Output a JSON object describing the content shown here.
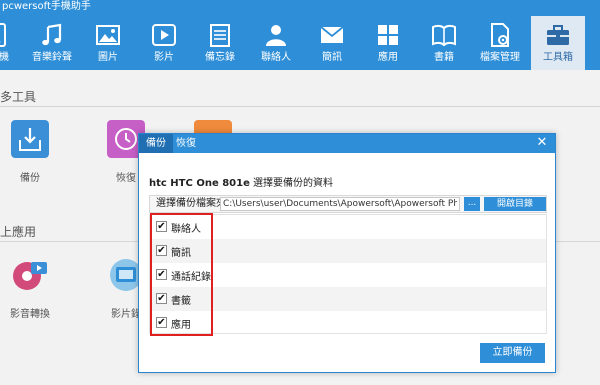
{
  "app": {
    "title": "pcwersoft手機助手"
  },
  "toolbar": {
    "items": [
      {
        "label": "手機",
        "icon": "phone-icon"
      },
      {
        "label": "音樂鈴聲",
        "icon": "music-note-icon"
      },
      {
        "label": "圖片",
        "icon": "picture-icon"
      },
      {
        "label": "影片",
        "icon": "video-play-icon"
      },
      {
        "label": "備忘錄",
        "icon": "notes-icon"
      },
      {
        "label": "聯絡人",
        "icon": "contact-icon"
      },
      {
        "label": "簡訊",
        "icon": "envelope-icon"
      },
      {
        "label": "應用",
        "icon": "apps-grid-icon"
      },
      {
        "label": "書籍",
        "icon": "book-icon"
      },
      {
        "label": "檔案管理",
        "icon": "file-manager-icon"
      },
      {
        "label": "工具箱",
        "icon": "toolbox-icon"
      }
    ],
    "active_index": 10,
    "bar_color": "#2e8fd8"
  },
  "main": {
    "section1_title": "多工具",
    "section2_title": "上應用",
    "tools": [
      {
        "label": "備份",
        "icon": "backup-icon"
      },
      {
        "label": "恢復",
        "icon": "restore-icon"
      }
    ],
    "apps": [
      {
        "label": "影音轉換",
        "icon": "video-converter-icon"
      },
      {
        "label": "影片錄",
        "icon": "screen-recorder-icon"
      }
    ]
  },
  "dialog": {
    "tabs": [
      "備份",
      "恢復"
    ],
    "active_tab": 0,
    "device_name": "htc HTC One 801e",
    "prompt": "選擇要備份的資料",
    "path_label": "選擇備份檔案夾",
    "path_value": "C:\\Users\\user\\Documents\\Apowersoft\\Apowersoft Pho",
    "browse_label": "...",
    "open_dir_label": "開啟目錄",
    "items": [
      {
        "label": "聯絡人",
        "checked": true
      },
      {
        "label": "簡訊",
        "checked": true
      },
      {
        "label": "通話紀錄",
        "checked": true
      },
      {
        "label": "書籤",
        "checked": true
      },
      {
        "label": "應用",
        "checked": true
      }
    ],
    "start_label": "立即備份",
    "highlight_color": "#e02020"
  }
}
